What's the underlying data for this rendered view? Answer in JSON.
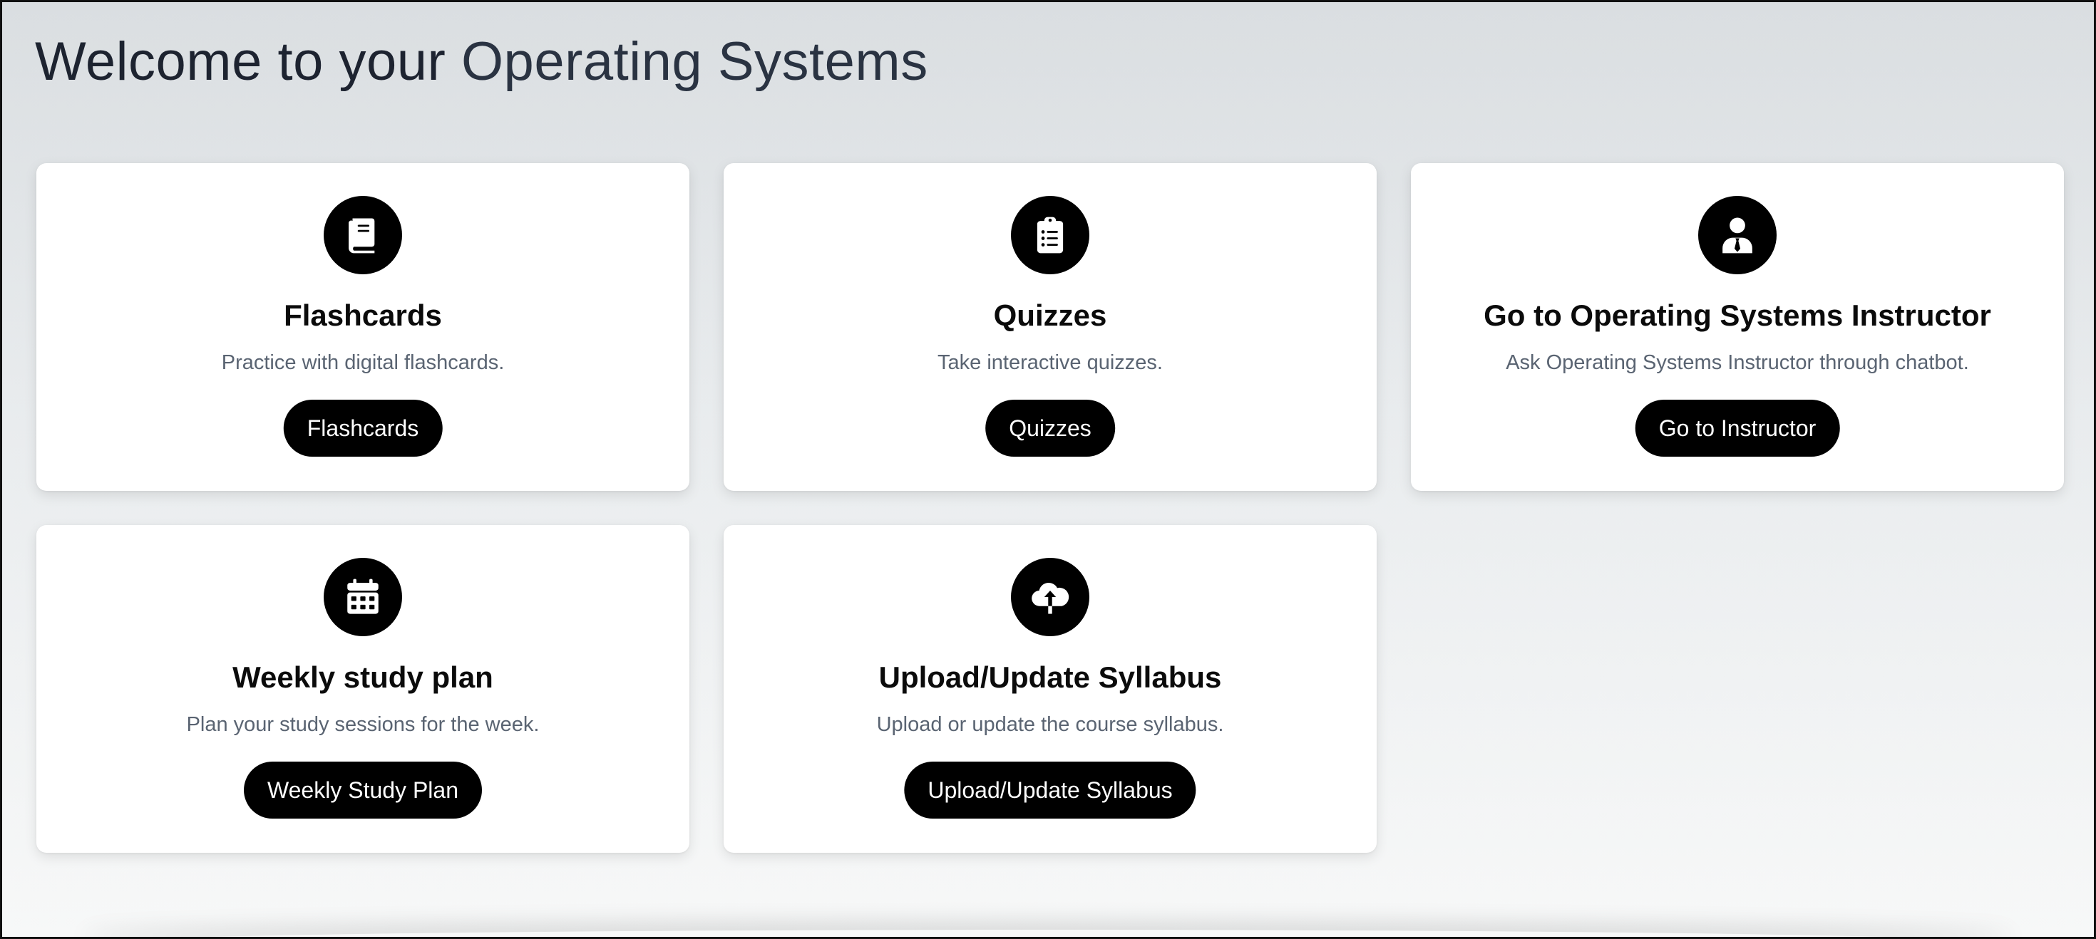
{
  "header": {
    "title_prefix": "Welcome to your ",
    "course_name": "Operating Systems"
  },
  "cards": [
    {
      "icon": "book-icon",
      "title": "Flashcards",
      "description": "Practice with digital flashcards.",
      "button_label": "Flashcards"
    },
    {
      "icon": "clipboard-list-icon",
      "title": "Quizzes",
      "description": "Take interactive quizzes.",
      "button_label": "Quizzes"
    },
    {
      "icon": "user-tie-icon",
      "title": "Go to Operating Systems Instructor",
      "description": "Ask Operating Systems Instructor through chatbot.",
      "button_label": "Go to Instructor"
    },
    {
      "icon": "calendar-icon",
      "title": "Weekly study plan",
      "description": "Plan your study sessions for the week.",
      "button_label": "Weekly Study Plan"
    },
    {
      "icon": "cloud-upload-icon",
      "title": "Upload/Update Syllabus",
      "description": "Upload or update the course syllabus.",
      "button_label": "Upload/Update Syllabus"
    }
  ],
  "colors": {
    "accent": "#000000",
    "card_background": "#ffffff",
    "description_text": "#5a6472",
    "title_text": "#1d2330"
  }
}
